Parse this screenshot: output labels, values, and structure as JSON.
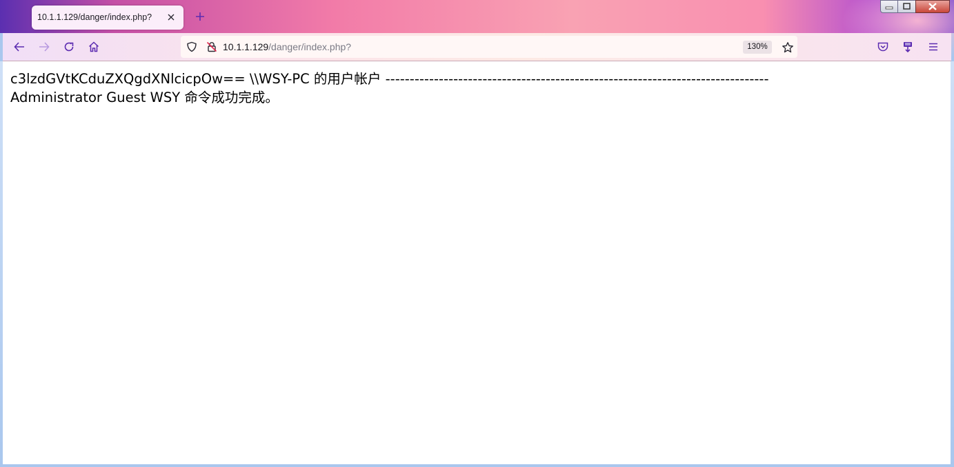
{
  "browser": {
    "tab": {
      "title": "10.1.1.129/danger/index.php?"
    },
    "url": {
      "host": "10.1.1.129",
      "path": "/danger/index.php?"
    },
    "zoom": "130%",
    "icons": {
      "back": "back-arrow-icon",
      "forward": "forward-arrow-icon",
      "reload": "reload-icon",
      "home": "home-icon",
      "shield": "shield-icon",
      "insecure": "insecure-lock-icon",
      "bookmark": "star-icon",
      "pocket": "pocket-icon",
      "extension": "extension-icon",
      "menu": "hamburger-menu-icon"
    },
    "accent_color": "#5b2bb0"
  },
  "page": {
    "line1": "c3lzdGVtKCduZXQgdXNlcicpOw== \\\\WSY-PC 的用户帐户 -------------------------------------------------------------------------------",
    "line2": "Administrator Guest WSY 命令成功完成。"
  }
}
